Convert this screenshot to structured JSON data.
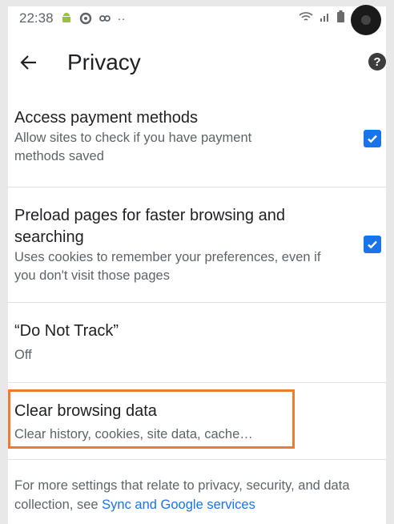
{
  "status_bar": {
    "time": "22:38",
    "icons": [
      "android-icon",
      "sync-icon",
      "link-icon",
      "more-notifications-icon"
    ],
    "right_icons": [
      "wifi-icon",
      "signal-icon",
      "battery-icon"
    ]
  },
  "header": {
    "back_icon": "arrow-left-icon",
    "title": "Privacy",
    "help_label": "?"
  },
  "settings": [
    {
      "title": "Access payment methods",
      "subtitle": "Allow sites to check if you have payment methods saved",
      "checked": true
    },
    {
      "title": "Preload pages for faster browsing and searching",
      "subtitle": "Uses cookies to remember your preferences, even if you don't visit those pages",
      "checked": true
    },
    {
      "title": "“Do Not Track”",
      "subtitle": "Off"
    },
    {
      "title": "Clear browsing data",
      "subtitle": "Clear history, cookies, site data, cache…"
    }
  ],
  "footer": {
    "text": "For more settings that relate to privacy, security, and data collection, see ",
    "link": "Sync and Google services"
  },
  "colors": {
    "accent": "#1a73e8",
    "highlight": "#f07a2e",
    "divider": "#e0e0e0"
  }
}
